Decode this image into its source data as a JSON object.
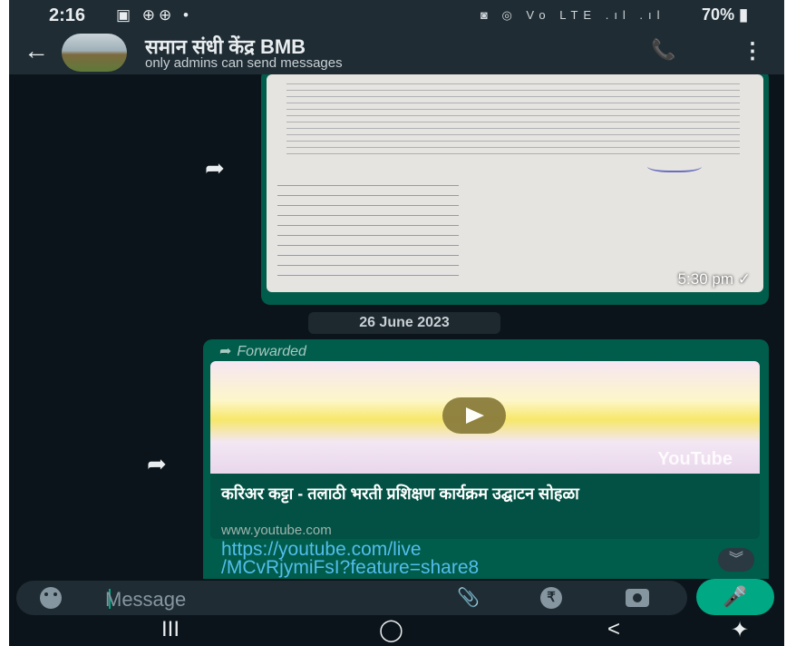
{
  "status_bar": {
    "time": "2:16",
    "left_icons": "▣ ⊕⊕ •",
    "right_icons": "◙ ◎ Vo LTE .ıl .ıl",
    "battery": "70%"
  },
  "header": {
    "group_name": "समान संधी केंद्र BMB",
    "subtitle": "only admins can send messages",
    "back_icon": "arrow-left",
    "call_icon": "phone-add",
    "menu_icon": "more-vertical"
  },
  "messages": [
    {
      "type": "image",
      "time": "5:30 pm",
      "status": "✓"
    },
    {
      "type": "date_separator",
      "text": "26 June 2023"
    },
    {
      "type": "link_preview",
      "forwarded_label": "Forwarded",
      "thumbnail_watermark": "YouTube",
      "preview_title": "करिअर कट्टा - तलाठी भरती प्रशिक्षण कार्यक्रम उद्घाटन सोहळा",
      "preview_domain": "www.youtube.com",
      "link_text": "https://youtube.com/live/MCvRjymiFsI?feature=share8"
    }
  ],
  "composer": {
    "placeholder": "Message",
    "icons": [
      "emoji-icon",
      "attach-icon",
      "rupee-icon",
      "camera-icon",
      "mic-icon"
    ]
  },
  "nav_bar": {
    "recent": "III",
    "home": "◯",
    "back": "<",
    "accessibility": "✦"
  },
  "colors": {
    "background": "#0b141a",
    "header": "#1f2c34",
    "outgoing_bubble": "#005c4b",
    "link": "#53bdeb",
    "accent": "#00a884"
  }
}
